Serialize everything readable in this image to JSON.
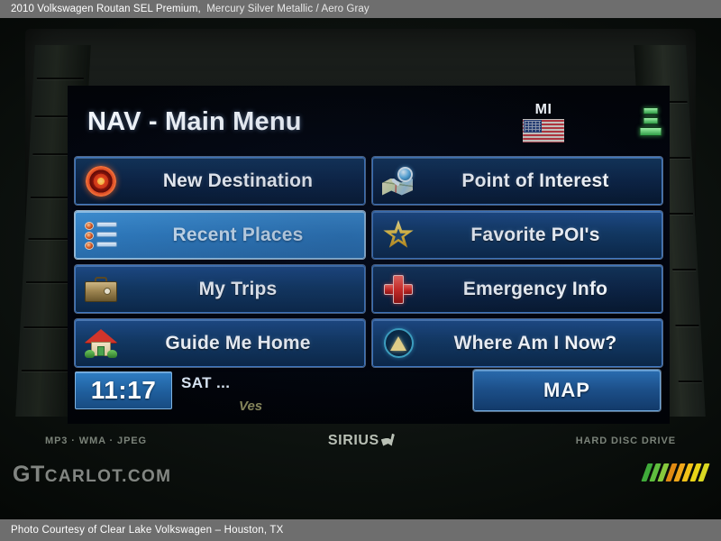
{
  "caption": {
    "vehicle": "2010 Volkswagen Routan SEL Premium,",
    "separator": "  ",
    "colors": "Mercury Silver Metallic / Aero Gray"
  },
  "screen": {
    "title": "NAV - Main Menu",
    "state_badge": {
      "label": "MI",
      "flag_icon": "us-flag-icon"
    },
    "seat_indicator_icon": "vehicle-seats-icon",
    "menu_items": [
      {
        "label": "New Destination",
        "icon": "target-icon",
        "state": "dark"
      },
      {
        "label": "Point of Interest",
        "icon": "map-search-icon",
        "state": "dark"
      },
      {
        "label": "Recent Places",
        "icon": "list-icon",
        "state": "highlight"
      },
      {
        "label": "Favorite POI's",
        "icon": "star-icon",
        "state": "normal"
      },
      {
        "label": "My Trips",
        "icon": "briefcase-icon",
        "state": "normal"
      },
      {
        "label": "Emergency Info",
        "icon": "red-cross-icon",
        "state": "dark"
      },
      {
        "label": "Guide Me Home",
        "icon": "house-icon",
        "state": "normal"
      },
      {
        "label": "Where Am I Now?",
        "icon": "compass-icon",
        "state": "normal"
      }
    ],
    "footer": {
      "clock": "11:17",
      "source": "SAT ...",
      "watermark": "Ves",
      "map_button": "MAP"
    }
  },
  "bezel": {
    "codecs": "MP3 · WMA · JPEG",
    "sirius_brand": "SIRIUS",
    "sirius_dog_icon": "sirius-dog-icon",
    "storage": "HARD DISC DRIVE"
  },
  "watermark": {
    "gt": "GT",
    "carlot": "CARLOT.COM",
    "stripe_colors": [
      "#3faa3a",
      "#5fbe3e",
      "#86c93d",
      "#e08a12",
      "#f0a71a",
      "#f3c218",
      "#e8d317",
      "#d9d822"
    ]
  },
  "credit": {
    "text": "Photo Courtesy of Clear Lake Volkswagen – Houston, TX"
  }
}
